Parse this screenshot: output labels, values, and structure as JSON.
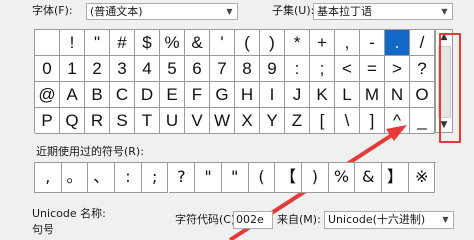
{
  "font": {
    "label": "字体(F):",
    "value": "(普通文本)"
  },
  "subset": {
    "label": "子集(U):",
    "value": "基本拉丁语"
  },
  "grid": {
    "rows": [
      [
        " ",
        "!",
        "\"",
        "#",
        "$",
        "%",
        "&",
        "'",
        "(",
        ")",
        "*",
        "+",
        ",",
        "-",
        ".",
        "/"
      ],
      [
        "0",
        "1",
        "2",
        "3",
        "4",
        "5",
        "6",
        "7",
        "8",
        "9",
        ":",
        ";",
        "<",
        "=",
        ">",
        "?"
      ],
      [
        "@",
        "A",
        "B",
        "C",
        "D",
        "E",
        "F",
        "G",
        "H",
        "I",
        "J",
        "K",
        "L",
        "M",
        "N",
        "O"
      ],
      [
        "P",
        "Q",
        "R",
        "S",
        "T",
        "U",
        "V",
        "W",
        "X",
        "Y",
        "Z",
        "[",
        "\\",
        "]",
        "^",
        "_"
      ]
    ]
  },
  "recent": {
    "label": "近期使用过的符号(R):",
    "symbols": [
      ",",
      "。",
      "、",
      ":",
      ";",
      "?",
      "\"",
      "\"",
      "(",
      "【",
      ")",
      "%",
      "&",
      "】",
      "※"
    ]
  },
  "unicode_name_label": "Unicode 名称:",
  "char_name": "句号",
  "char_code": {
    "label": "字符代码(C):",
    "value": "002e"
  },
  "from": {
    "label": "来自(M):",
    "value": "Unicode(十六进制)"
  },
  "colors": {
    "selected": "#1168c7",
    "annotation": "#e43a3a"
  }
}
